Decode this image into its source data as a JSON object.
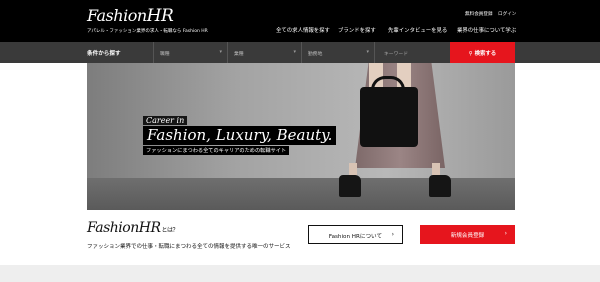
{
  "header": {
    "logo_fashion": "Fashion",
    "logo_hr": "HR",
    "tagline": "アパレル・ファッション業界の求人・転職なら Fashion HR",
    "signup_link": "無料会員登録",
    "login_link": "ログイン",
    "nav": [
      "全ての求人情報を探す",
      "ブランドを探す",
      "先輩インタビューを見る",
      "業界の仕事について学ぶ"
    ]
  },
  "search": {
    "title": "条件から探す",
    "selects": [
      "職種",
      "業種",
      "勤務地"
    ],
    "keyword_placeholder": "キーワード",
    "button_label": "検索する"
  },
  "hero": {
    "kicker": "Career in",
    "headline": "Fashion, Luxury, Beauty.",
    "subtitle": "ファッションにまつわる全てのキャリアのための転職サイト"
  },
  "about": {
    "logo_fashion": "Fashion",
    "logo_hr": "HR",
    "logo_suffix": "とは？",
    "description": "ファッション業界での仕事・転職にまつわる全ての情報を提供する唯一のサービス",
    "about_button": "Fashion HRについて",
    "signup_button": "新規会員登録"
  },
  "colors": {
    "accent": "#e6151d",
    "header_bg": "#000000",
    "searchbar_bg": "#3a3a3a"
  }
}
